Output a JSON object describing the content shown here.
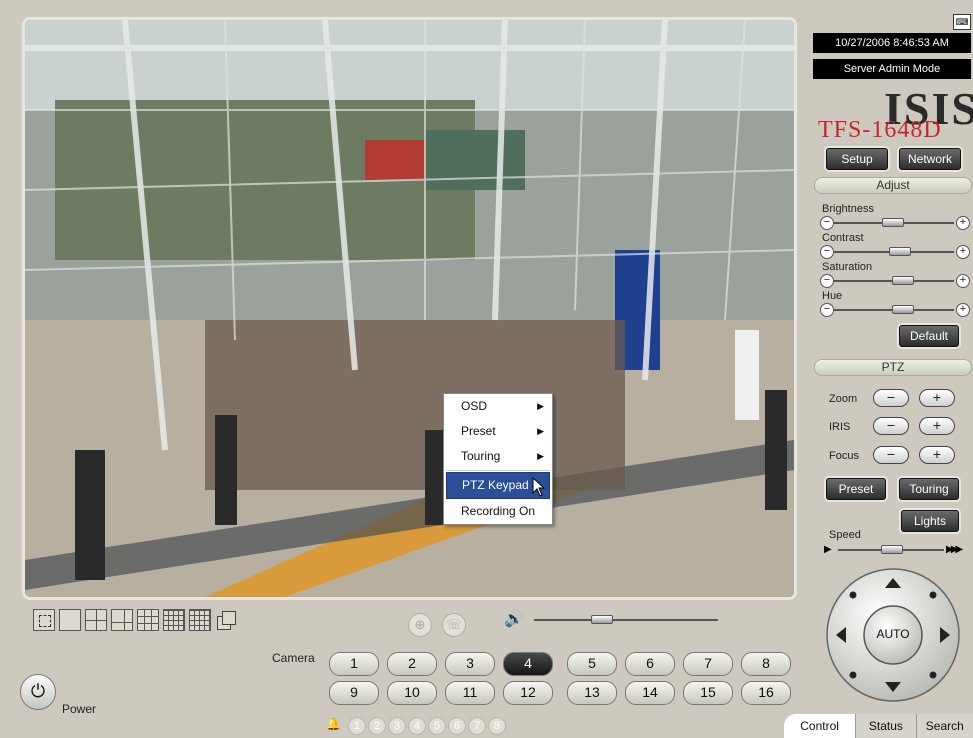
{
  "header": {
    "datetime": "10/27/2006 8:46:53 AM",
    "mode": "Server Admin Mode"
  },
  "brand": {
    "logo": "ISIS",
    "model": "TFS-1648D"
  },
  "buttons": {
    "setup": "Setup",
    "network": "Network",
    "default": "Default",
    "preset": "Preset",
    "touring": "Touring",
    "lights": "Lights",
    "auto": "AUTO"
  },
  "adjust": {
    "title": "Adjust",
    "sliders": [
      {
        "label": "Brightness",
        "level": 0.48
      },
      {
        "label": "Contrast",
        "level": 0.55
      },
      {
        "label": "Saturation",
        "level": 0.58
      },
      {
        "label": "Hue",
        "level": 0.58
      }
    ]
  },
  "ptz": {
    "title": "PTZ",
    "rows": [
      {
        "label": "Zoom",
        "minus": "−",
        "plus": "+"
      },
      {
        "label": "IRIS",
        "minus": "−",
        "plus": "+"
      },
      {
        "label": "Focus",
        "minus": "−",
        "plus": "+"
      }
    ],
    "speed": {
      "label": "Speed",
      "level": 0.5
    }
  },
  "context_menu": {
    "items": [
      {
        "label": "OSD",
        "submenu": true
      },
      {
        "label": "Preset",
        "submenu": true
      },
      {
        "label": "Touring",
        "submenu": true
      },
      {
        "label": "PTZ Keypad",
        "submenu": false,
        "highlighted": true
      },
      {
        "label": "Recording On",
        "submenu": false
      }
    ]
  },
  "camera": {
    "label": "Camera",
    "selected": "4",
    "row1": [
      "1",
      "2",
      "3",
      "4",
      "5",
      "6",
      "7",
      "8"
    ],
    "row2": [
      "9",
      "10",
      "11",
      "12",
      "13",
      "14",
      "15",
      "16"
    ]
  },
  "power": {
    "label": "Power"
  },
  "alarms": [
    "1",
    "2",
    "3",
    "4",
    "5",
    "6",
    "7",
    "8"
  ],
  "volume": {
    "level": 0.35
  },
  "tabs": [
    "Control",
    "Status",
    "Search"
  ],
  "colors": {
    "panel": "#cdc9be",
    "model_red": "#c8252b",
    "menu_highlight": "#2a4f98"
  }
}
